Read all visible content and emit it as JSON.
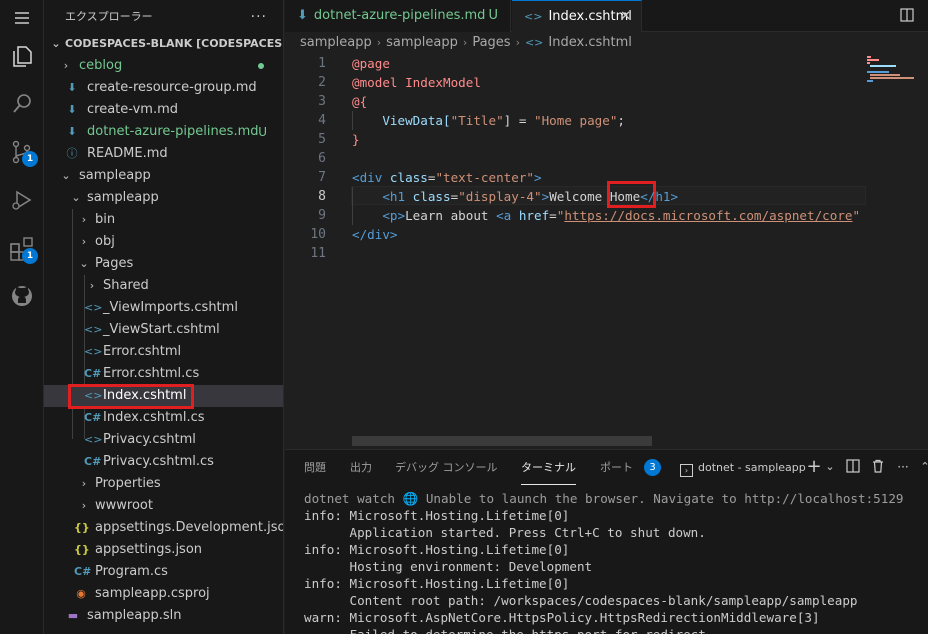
{
  "activity_bar": {
    "icons": [
      "menu-icon",
      "explorer-icon",
      "search-icon",
      "source-control-icon",
      "run-debug-icon",
      "extensions-icon",
      "github-icon"
    ],
    "source_control_badge": "1",
    "extensions_badge": "1"
  },
  "sidebar": {
    "title": "エクスプローラー",
    "more": "···",
    "root": "CODESPACES-BLANK [CODESPACES]",
    "items": [
      {
        "label": "ceblog",
        "kind": "folder",
        "status": "dot"
      },
      {
        "label": "create-resource-group.md",
        "kind": "md"
      },
      {
        "label": "create-vm.md",
        "kind": "md"
      },
      {
        "label": "dotnet-azure-pipelines.md",
        "kind": "md",
        "status": "U"
      },
      {
        "label": "README.md",
        "kind": "info"
      },
      {
        "label": "sampleapp",
        "kind": "folder"
      },
      {
        "label": "sampleapp",
        "kind": "folder"
      },
      {
        "label": "bin",
        "kind": "folder"
      },
      {
        "label": "obj",
        "kind": "folder"
      },
      {
        "label": "Pages",
        "kind": "folder"
      },
      {
        "label": "Shared",
        "kind": "folder"
      },
      {
        "label": "_ViewImports.cshtml",
        "kind": "html"
      },
      {
        "label": "_ViewStart.cshtml",
        "kind": "html"
      },
      {
        "label": "Error.cshtml",
        "kind": "html"
      },
      {
        "label": "Error.cshtml.cs",
        "kind": "cs"
      },
      {
        "label": "Index.cshtml",
        "kind": "html"
      },
      {
        "label": "Index.cshtml.cs",
        "kind": "cs"
      },
      {
        "label": "Privacy.cshtml",
        "kind": "html"
      },
      {
        "label": "Privacy.cshtml.cs",
        "kind": "cs"
      },
      {
        "label": "Properties",
        "kind": "folder"
      },
      {
        "label": "wwwroot",
        "kind": "folder"
      },
      {
        "label": "appsettings.Development.json",
        "kind": "json"
      },
      {
        "label": "appsettings.json",
        "kind": "json"
      },
      {
        "label": "Program.cs",
        "kind": "cs"
      },
      {
        "label": "sampleapp.csproj",
        "kind": "proj"
      },
      {
        "label": "sampleapp.sln",
        "kind": "sln"
      }
    ]
  },
  "tabs": [
    {
      "label": "dotnet-azure-pipelines.md",
      "status": "U"
    },
    {
      "label": "Index.cshtml",
      "close": "✕"
    }
  ],
  "breadcrumb": [
    "sampleapp",
    "sampleapp",
    "Pages",
    "Index.cshtml"
  ],
  "editor": {
    "line_numbers": [
      "1",
      "2",
      "3",
      "4",
      "5",
      "6",
      "7",
      "8",
      "9",
      "10",
      "11"
    ],
    "current_line": "8",
    "lines": [
      [
        {
          "t": "@page",
          "c": "razor"
        }
      ],
      [
        {
          "t": "@model ",
          "c": "razor"
        },
        {
          "t": "IndexModel",
          "c": "razor"
        }
      ],
      [
        {
          "t": "@{",
          "c": "razor"
        }
      ],
      [
        {
          "t": "    ViewData[",
          "c": "attr"
        },
        {
          "t": "\"Title\"",
          "c": "str"
        },
        {
          "t": "] = ",
          "c": "text"
        },
        {
          "t": "\"Home page\"",
          "c": "str"
        },
        {
          "t": ";",
          "c": "text"
        }
      ],
      [
        {
          "t": "}",
          "c": "razor"
        }
      ],
      [],
      [
        {
          "t": "<div ",
          "c": "tag"
        },
        {
          "t": "class",
          "c": "attr"
        },
        {
          "t": "=",
          "c": "text"
        },
        {
          "t": "\"text-center\"",
          "c": "str"
        },
        {
          "t": ">",
          "c": "tag"
        }
      ],
      [
        {
          "t": "    <h1 ",
          "c": "tag"
        },
        {
          "t": "class",
          "c": "attr"
        },
        {
          "t": "=",
          "c": "text"
        },
        {
          "t": "\"display-4\"",
          "c": "str"
        },
        {
          "t": ">",
          "c": "tag"
        },
        {
          "t": "Welcome Home",
          "c": "text"
        },
        {
          "t": "</h1>",
          "c": "tag"
        }
      ],
      [
        {
          "t": "    <p>",
          "c": "tag"
        },
        {
          "t": "Learn about ",
          "c": "text"
        },
        {
          "t": "<a ",
          "c": "tag"
        },
        {
          "t": "href",
          "c": "attr"
        },
        {
          "t": "=",
          "c": "text"
        },
        {
          "t": "\"",
          "c": "str"
        },
        {
          "t": "https://docs.microsoft.com/aspnet/core",
          "c": "link"
        },
        {
          "t": "\"",
          "c": "str"
        }
      ],
      [
        {
          "t": "</div>",
          "c": "tag"
        }
      ],
      []
    ]
  },
  "panel": {
    "tabs": [
      "問題",
      "出力",
      "デバッグ コンソール",
      "ターミナル",
      "ポート"
    ],
    "active_tab": "ターミナル",
    "ports_badge": "3",
    "terminal_name": "dotnet - sampleapp",
    "actions": [
      "+",
      "⌄",
      "split-icon",
      "trash-icon",
      "···",
      "⌃",
      "✕"
    ],
    "terminal_lines": [
      "dotnet watch 🌐 Unable to launch the browser. Navigate to http://localhost:5129",
      "info: Microsoft.Hosting.Lifetime[0]",
      "      Application started. Press Ctrl+C to shut down.",
      "info: Microsoft.Hosting.Lifetime[0]",
      "      Hosting environment: Development",
      "info: Microsoft.Hosting.Lifetime[0]",
      "      Content root path: /workspaces/codespaces-blank/sampleapp/sampleapp",
      "warn: Microsoft.AspNetCore.HttpsPolicy.HttpsRedirectionMiddleware[3]",
      "      Failed to determine the https port for redirect."
    ]
  },
  "colors": {
    "highlight": "#e02020",
    "accent": "#0078d4",
    "git_added": "#73c991"
  }
}
